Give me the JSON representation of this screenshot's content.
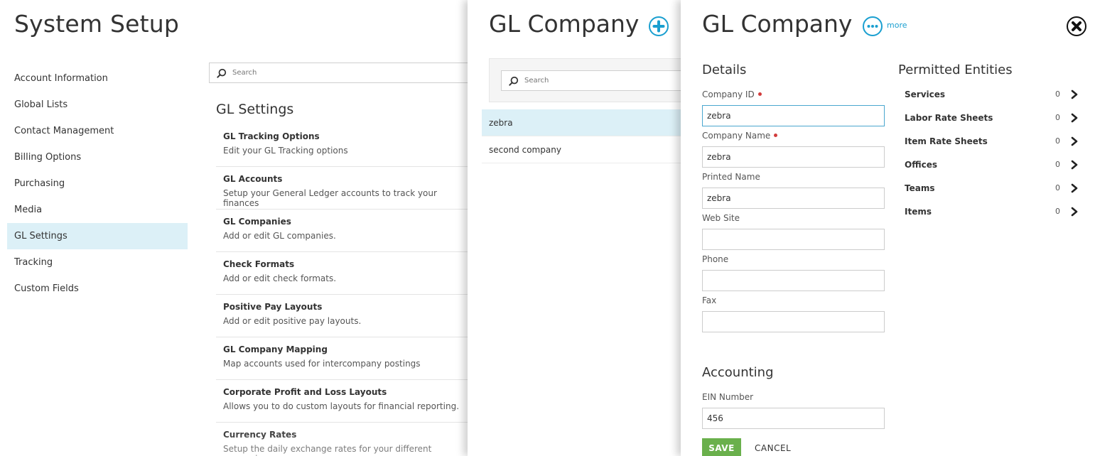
{
  "system_setup": {
    "title": "System Setup",
    "nav": [
      {
        "label": "Account Information"
      },
      {
        "label": "Global Lists"
      },
      {
        "label": "Contact Management"
      },
      {
        "label": "Billing Options"
      },
      {
        "label": "Purchasing"
      },
      {
        "label": "Media"
      },
      {
        "label": "GL Settings",
        "active": true
      },
      {
        "label": "Tracking"
      },
      {
        "label": "Custom Fields"
      }
    ],
    "search_placeholder": "Search",
    "section_title": "GL Settings",
    "settings": [
      {
        "title": "GL Tracking Options",
        "desc": "Edit your GL Tracking options"
      },
      {
        "title": "GL Accounts",
        "desc": "Setup your General Ledger accounts to track your finances"
      },
      {
        "title": "GL Companies",
        "desc": "Add or edit GL companies."
      },
      {
        "title": "Check Formats",
        "desc": "Add or edit check formats."
      },
      {
        "title": "Positive Pay Layouts",
        "desc": "Add or edit positive pay layouts."
      },
      {
        "title": "GL Company Mapping",
        "desc": "Map accounts used for intercompany postings"
      },
      {
        "title": "Corporate Profit and Loss Layouts",
        "desc": "Allows you to do custom layouts for financial reporting."
      },
      {
        "title": "Currency Rates",
        "desc": "Setup the daily exchange rates for your different currencies"
      }
    ]
  },
  "company_list": {
    "title": "GL Company",
    "search_placeholder": "Search",
    "companies": [
      {
        "name": "zebra",
        "selected": true
      },
      {
        "name": "second company"
      }
    ]
  },
  "company_detail": {
    "title": "GL Company",
    "more_label": "more",
    "details_title": "Details",
    "fields": {
      "company_id": {
        "label": "Company ID",
        "value": "zebra",
        "required": true
      },
      "company_name": {
        "label": "Company Name",
        "value": "zebra",
        "required": true
      },
      "printed_name": {
        "label": "Printed Name",
        "value": "zebra"
      },
      "web_site": {
        "label": "Web Site",
        "value": ""
      },
      "phone": {
        "label": "Phone",
        "value": ""
      },
      "fax": {
        "label": "Fax",
        "value": ""
      }
    },
    "accounting_title": "Accounting",
    "ein": {
      "label": "EIN Number",
      "value": "456"
    },
    "permitted_title": "Permitted Entities",
    "entities": [
      {
        "name": "Services",
        "count": "0"
      },
      {
        "name": "Labor Rate Sheets",
        "count": "0"
      },
      {
        "name": "Item Rate Sheets",
        "count": "0"
      },
      {
        "name": "Offices",
        "count": "0"
      },
      {
        "name": "Teams",
        "count": "0"
      },
      {
        "name": "Items",
        "count": "0"
      }
    ],
    "save_label": "SAVE",
    "cancel_label": "CANCEL"
  },
  "colors": {
    "accent": "#1a9fd0",
    "selected_bg": "#dcf0f7",
    "save_green": "#6ab04c",
    "required_red": "#d23c3c"
  }
}
